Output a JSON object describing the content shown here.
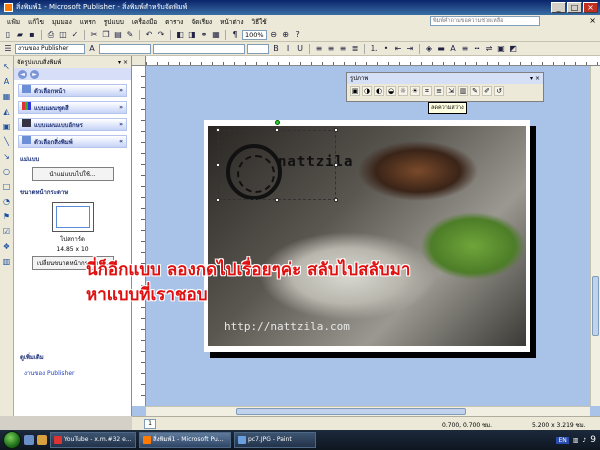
{
  "window": {
    "title": "สิ่งพิมพ์1 - Microsoft Publisher - สิ่งพิมพ์สำหรับจัดพิมพ์",
    "buttons": [
      "_",
      "□",
      "×"
    ]
  },
  "menu": {
    "items": [
      "แฟ้ม",
      "แก้ไข",
      "มุมมอง",
      "แทรก",
      "รูปแบบ",
      "เครื่องมือ",
      "ตาราง",
      "จัดเรียง",
      "หน้าต่าง",
      "วิธีใช้"
    ],
    "help_placeholder": "พิมพ์คำถามขอความช่วยเหลือ",
    "close": "×"
  },
  "toolbar": {
    "zoom": "100%",
    "task_pane_label": "งานของ Publisher"
  },
  "task_pane": {
    "title": "จัดรูปแบบสิ่งพิมพ์",
    "nav_back": "◄",
    "nav_forward": "►",
    "sections": [
      "ตัวเลือกหน้า",
      "แบบแผนชุดสี",
      "แบบแผนแบบอักษร",
      "ตัวเลือกสิ่งพิมพ์"
    ],
    "template_label": "แม่แบบ",
    "change_template_button": "นำแม่แบบไปใช้...",
    "paper_size_label": "ขนาดหน้ากระดาษ",
    "paper_name": "โปสการ์ด",
    "paper_dims": "14.85 x 10",
    "change_size_button": "เปลี่ยนขนาดหน้ากระดาษ...",
    "see_also_label": "ดูเพิ่มเติม",
    "see_also_link": "งานของ Publisher"
  },
  "picture_toolbar": {
    "title": "รูปภาพ",
    "tooltip": "ลดความสว่าง"
  },
  "page_content": {
    "logo_text": "nattzila",
    "watermark": "http://nattzila.com"
  },
  "status": {
    "page_number": "1",
    "position": "0.700, 0.700 ซม.",
    "size": "5.200 x 3.219 ซม."
  },
  "caption": {
    "line1": "นี่ก็อีกแบบ ลองกดไปเรื่อยๆค่ะ สลับไปสลับมา",
    "line2": "หาแบบที่เราชอบ"
  },
  "taskbar": {
    "tasks": [
      {
        "label": "YouTube - x.m.#32 e...",
        "color": "#d33"
      },
      {
        "label": "สิ่งพิมพ์1 - Microsoft Pu...",
        "color": "#ff7a00"
      },
      {
        "label": "pc7.JPG - Paint",
        "color": "#6aa0e0"
      }
    ],
    "lang": "EN",
    "clock": "9"
  }
}
